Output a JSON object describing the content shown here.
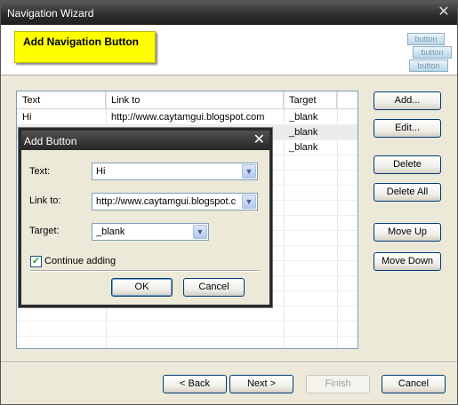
{
  "window": {
    "title": "Navigation Wizard"
  },
  "header": {
    "banner_text": "Add Navigation Button",
    "icon_labels": [
      "button",
      "button",
      "button"
    ]
  },
  "table": {
    "columns": [
      "Text",
      "Link to",
      "Target"
    ],
    "rows": [
      {
        "text": "Hi",
        "link": "http://www.caytamgui.blogspot.com",
        "target": "_blank"
      },
      {
        "text": "",
        "link": "",
        "target": "_blank"
      },
      {
        "text": "",
        "link": "",
        "target": "_blank"
      }
    ]
  },
  "side_buttons": {
    "add": "Add...",
    "edit": "Edit...",
    "delete": "Delete",
    "delete_all": "Delete All",
    "move_up": "Move Up",
    "move_down": "Move Down"
  },
  "footer_buttons": {
    "back": "< Back",
    "next": "Next >",
    "finish": "Finish",
    "cancel": "Cancel"
  },
  "dialog": {
    "title": "Add Button",
    "text_label": "Text:",
    "text_value": "Hi",
    "link_label": "Link to:",
    "link_value": "http://www.caytamgui.blogspot.c",
    "target_label": "Target:",
    "target_value": "_blank",
    "continue_label": "Continue adding",
    "continue_checked": true,
    "ok": "OK",
    "cancel": "Cancel"
  }
}
